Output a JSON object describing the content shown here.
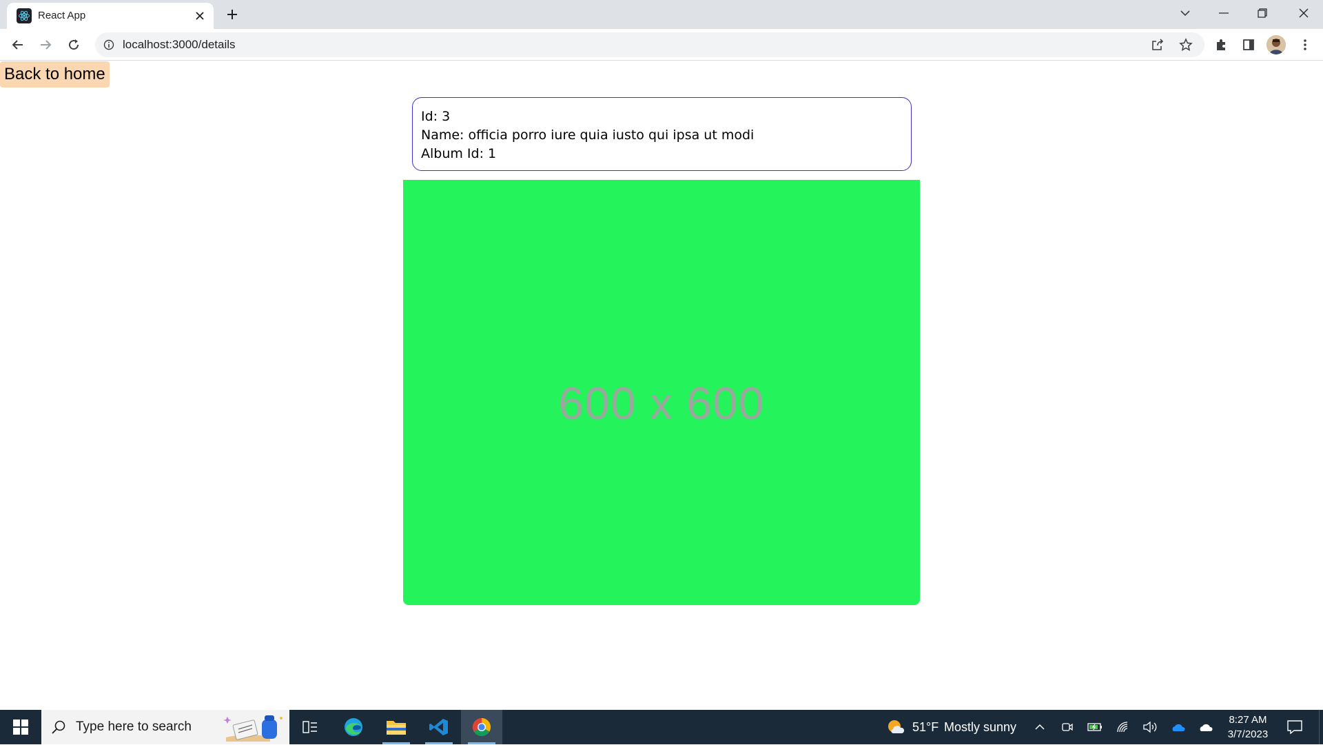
{
  "browser": {
    "tab": {
      "title": "React App",
      "icon": "react-logo-icon"
    },
    "address_bar": {
      "url": "localhost:3000/details"
    },
    "colors": {
      "tabstrip": "#dee1e6",
      "omnibox": "#f1f3f4"
    }
  },
  "page": {
    "back_button": {
      "label": "Back to home",
      "color": "#fbd7b1"
    },
    "details": {
      "id_line": "Id: 3",
      "name_line": "Name: officia porro iure quia iusto qui ipsa ut modi",
      "album_line": "Album Id: 1",
      "border_color": "#3a2fd0"
    },
    "photo": {
      "placeholder_text": "600 x 600",
      "background": "#24f35b"
    }
  },
  "taskbar": {
    "search_placeholder": "Type here to search",
    "apps": [
      "task-view",
      "edge",
      "file-explorer",
      "vscode",
      "chrome"
    ],
    "active_app": "chrome",
    "weather": {
      "temp": "51°F",
      "condition": "Mostly sunny"
    },
    "clock": {
      "time": "8:27 AM",
      "date": "3/7/2023"
    }
  }
}
